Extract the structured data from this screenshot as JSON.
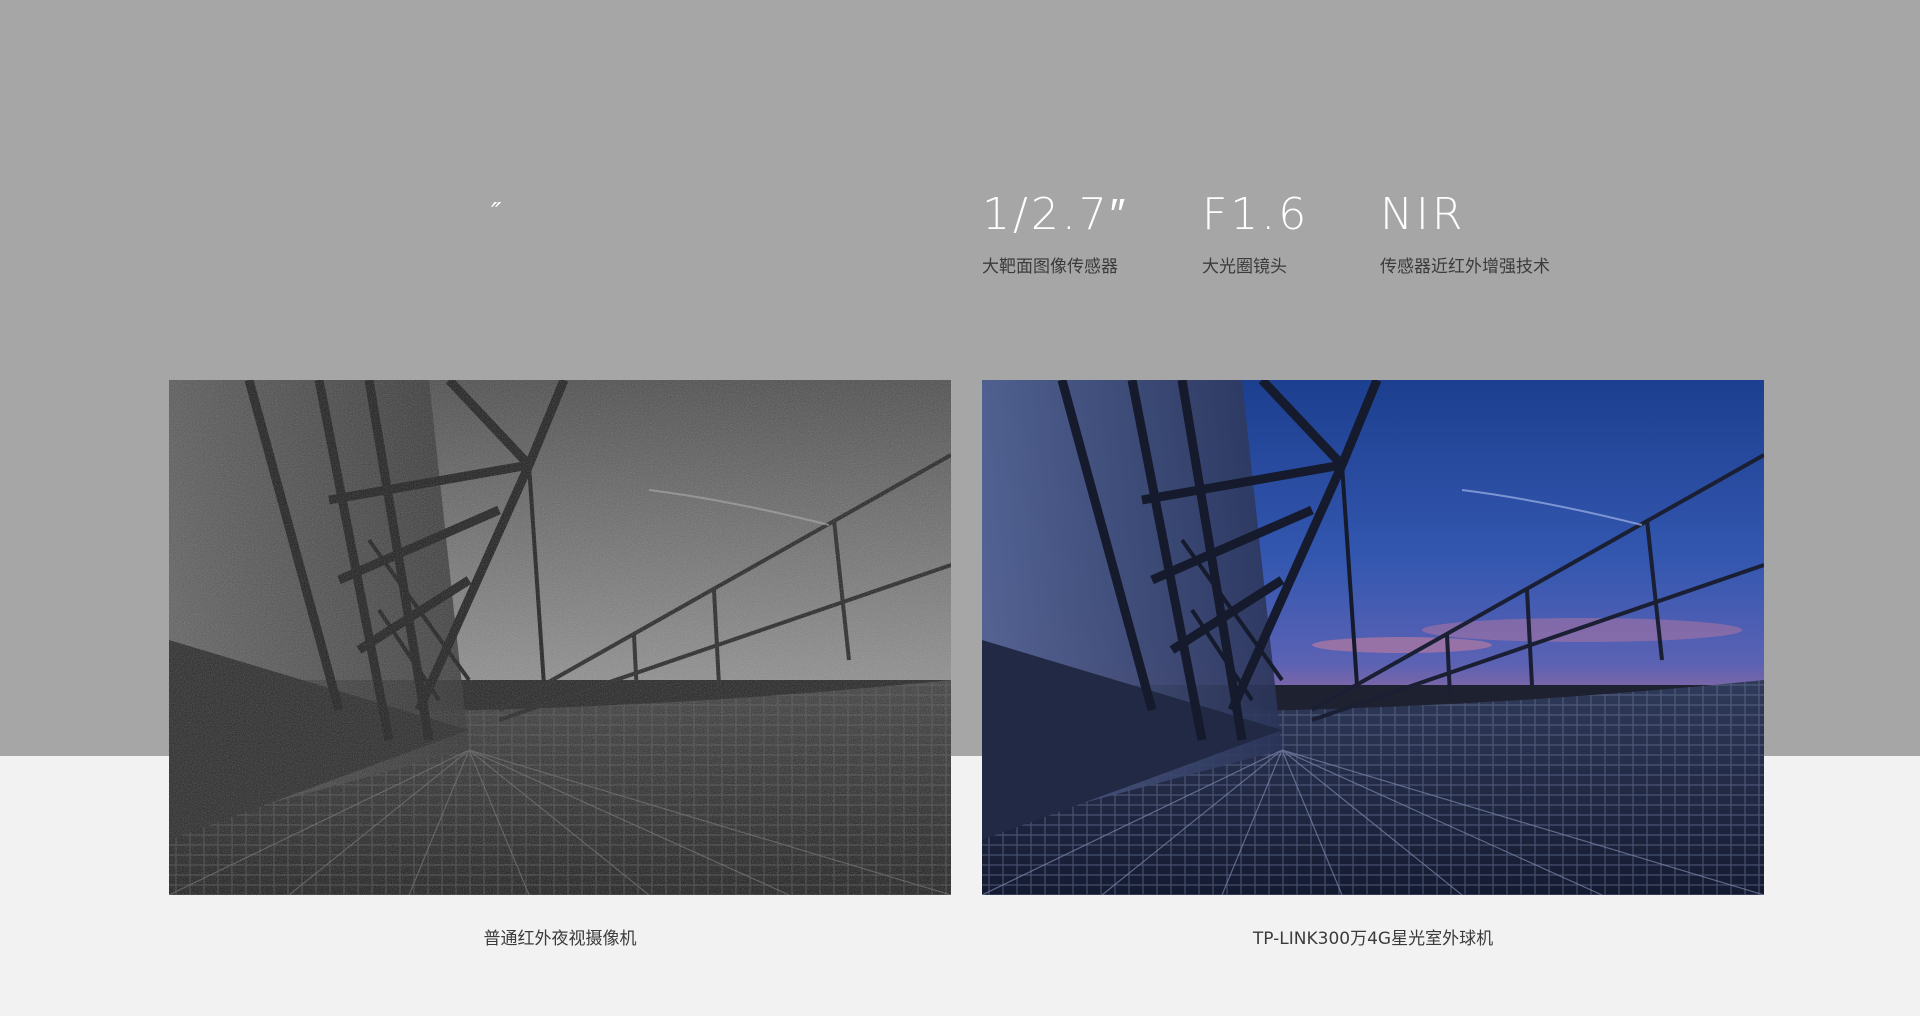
{
  "stray_mark": "″",
  "specs": [
    {
      "value": "1/2.7″",
      "label": "大靶面图像传感器"
    },
    {
      "value": "F1.6",
      "label": "大光圈镜头"
    },
    {
      "value": "NIR",
      "label": "传感器近红外增强技术"
    }
  ],
  "comparison": {
    "left_caption": "普通红外夜视摄像机",
    "right_caption": "TP-LINK300万4G星光室外球机"
  },
  "colors": {
    "top_band": "#a6a6a6",
    "bottom_band": "#f2f2f2",
    "spec_value": "#ffffff",
    "text_dark": "#3b3b3b"
  },
  "images": {
    "left": "grayscale-noisy-night-bridge-photo",
    "right": "color-starlight-night-bridge-photo"
  }
}
